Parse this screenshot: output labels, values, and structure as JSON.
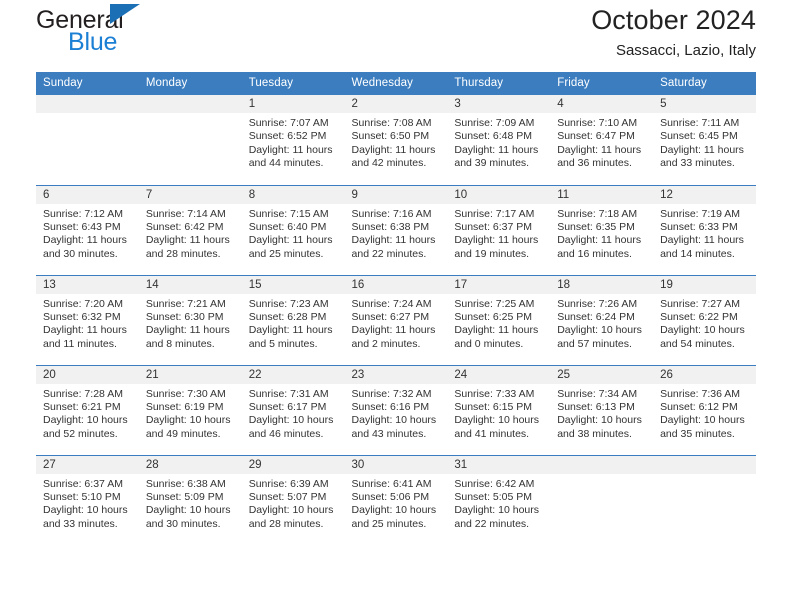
{
  "brand": {
    "name_top": "General",
    "name_bottom": "Blue",
    "triangle_color": "#1b6fb4",
    "text_color": "#231f20",
    "blue_text_color": "#1b7fd4"
  },
  "header": {
    "title": "October 2024",
    "subtitle": "Sassacci, Lazio, Italy"
  },
  "theme": {
    "header_blue": "#3b7dbf",
    "date_band_gray": "#f1f1f1",
    "text_color": "#333333"
  },
  "weekdays": [
    "Sunday",
    "Monday",
    "Tuesday",
    "Wednesday",
    "Thursday",
    "Friday",
    "Saturday"
  ],
  "labels": {
    "sunrise_prefix": "Sunrise:",
    "sunset_prefix": "Sunset:",
    "daylight_prefix": "Daylight:"
  },
  "weeks": [
    [
      {
        "day": "",
        "empty": true
      },
      {
        "day": "",
        "empty": true
      },
      {
        "day": "1",
        "sunrise": "Sunrise: 7:07 AM",
        "sunset": "Sunset: 6:52 PM",
        "daylight_line1": "Daylight: 11 hours",
        "daylight_line2": "and 44 minutes."
      },
      {
        "day": "2",
        "sunrise": "Sunrise: 7:08 AM",
        "sunset": "Sunset: 6:50 PM",
        "daylight_line1": "Daylight: 11 hours",
        "daylight_line2": "and 42 minutes."
      },
      {
        "day": "3",
        "sunrise": "Sunrise: 7:09 AM",
        "sunset": "Sunset: 6:48 PM",
        "daylight_line1": "Daylight: 11 hours",
        "daylight_line2": "and 39 minutes."
      },
      {
        "day": "4",
        "sunrise": "Sunrise: 7:10 AM",
        "sunset": "Sunset: 6:47 PM",
        "daylight_line1": "Daylight: 11 hours",
        "daylight_line2": "and 36 minutes."
      },
      {
        "day": "5",
        "sunrise": "Sunrise: 7:11 AM",
        "sunset": "Sunset: 6:45 PM",
        "daylight_line1": "Daylight: 11 hours",
        "daylight_line2": "and 33 minutes."
      }
    ],
    [
      {
        "day": "6",
        "sunrise": "Sunrise: 7:12 AM",
        "sunset": "Sunset: 6:43 PM",
        "daylight_line1": "Daylight: 11 hours",
        "daylight_line2": "and 30 minutes."
      },
      {
        "day": "7",
        "sunrise": "Sunrise: 7:14 AM",
        "sunset": "Sunset: 6:42 PM",
        "daylight_line1": "Daylight: 11 hours",
        "daylight_line2": "and 28 minutes."
      },
      {
        "day": "8",
        "sunrise": "Sunrise: 7:15 AM",
        "sunset": "Sunset: 6:40 PM",
        "daylight_line1": "Daylight: 11 hours",
        "daylight_line2": "and 25 minutes."
      },
      {
        "day": "9",
        "sunrise": "Sunrise: 7:16 AM",
        "sunset": "Sunset: 6:38 PM",
        "daylight_line1": "Daylight: 11 hours",
        "daylight_line2": "and 22 minutes."
      },
      {
        "day": "10",
        "sunrise": "Sunrise: 7:17 AM",
        "sunset": "Sunset: 6:37 PM",
        "daylight_line1": "Daylight: 11 hours",
        "daylight_line2": "and 19 minutes."
      },
      {
        "day": "11",
        "sunrise": "Sunrise: 7:18 AM",
        "sunset": "Sunset: 6:35 PM",
        "daylight_line1": "Daylight: 11 hours",
        "daylight_line2": "and 16 minutes."
      },
      {
        "day": "12",
        "sunrise": "Sunrise: 7:19 AM",
        "sunset": "Sunset: 6:33 PM",
        "daylight_line1": "Daylight: 11 hours",
        "daylight_line2": "and 14 minutes."
      }
    ],
    [
      {
        "day": "13",
        "sunrise": "Sunrise: 7:20 AM",
        "sunset": "Sunset: 6:32 PM",
        "daylight_line1": "Daylight: 11 hours",
        "daylight_line2": "and 11 minutes."
      },
      {
        "day": "14",
        "sunrise": "Sunrise: 7:21 AM",
        "sunset": "Sunset: 6:30 PM",
        "daylight_line1": "Daylight: 11 hours",
        "daylight_line2": "and 8 minutes."
      },
      {
        "day": "15",
        "sunrise": "Sunrise: 7:23 AM",
        "sunset": "Sunset: 6:28 PM",
        "daylight_line1": "Daylight: 11 hours",
        "daylight_line2": "and 5 minutes."
      },
      {
        "day": "16",
        "sunrise": "Sunrise: 7:24 AM",
        "sunset": "Sunset: 6:27 PM",
        "daylight_line1": "Daylight: 11 hours",
        "daylight_line2": "and 2 minutes."
      },
      {
        "day": "17",
        "sunrise": "Sunrise: 7:25 AM",
        "sunset": "Sunset: 6:25 PM",
        "daylight_line1": "Daylight: 11 hours",
        "daylight_line2": "and 0 minutes."
      },
      {
        "day": "18",
        "sunrise": "Sunrise: 7:26 AM",
        "sunset": "Sunset: 6:24 PM",
        "daylight_line1": "Daylight: 10 hours",
        "daylight_line2": "and 57 minutes."
      },
      {
        "day": "19",
        "sunrise": "Sunrise: 7:27 AM",
        "sunset": "Sunset: 6:22 PM",
        "daylight_line1": "Daylight: 10 hours",
        "daylight_line2": "and 54 minutes."
      }
    ],
    [
      {
        "day": "20",
        "sunrise": "Sunrise: 7:28 AM",
        "sunset": "Sunset: 6:21 PM",
        "daylight_line1": "Daylight: 10 hours",
        "daylight_line2": "and 52 minutes."
      },
      {
        "day": "21",
        "sunrise": "Sunrise: 7:30 AM",
        "sunset": "Sunset: 6:19 PM",
        "daylight_line1": "Daylight: 10 hours",
        "daylight_line2": "and 49 minutes."
      },
      {
        "day": "22",
        "sunrise": "Sunrise: 7:31 AM",
        "sunset": "Sunset: 6:17 PM",
        "daylight_line1": "Daylight: 10 hours",
        "daylight_line2": "and 46 minutes."
      },
      {
        "day": "23",
        "sunrise": "Sunrise: 7:32 AM",
        "sunset": "Sunset: 6:16 PM",
        "daylight_line1": "Daylight: 10 hours",
        "daylight_line2": "and 43 minutes."
      },
      {
        "day": "24",
        "sunrise": "Sunrise: 7:33 AM",
        "sunset": "Sunset: 6:15 PM",
        "daylight_line1": "Daylight: 10 hours",
        "daylight_line2": "and 41 minutes."
      },
      {
        "day": "25",
        "sunrise": "Sunrise: 7:34 AM",
        "sunset": "Sunset: 6:13 PM",
        "daylight_line1": "Daylight: 10 hours",
        "daylight_line2": "and 38 minutes."
      },
      {
        "day": "26",
        "sunrise": "Sunrise: 7:36 AM",
        "sunset": "Sunset: 6:12 PM",
        "daylight_line1": "Daylight: 10 hours",
        "daylight_line2": "and 35 minutes."
      }
    ],
    [
      {
        "day": "27",
        "sunrise": "Sunrise: 6:37 AM",
        "sunset": "Sunset: 5:10 PM",
        "daylight_line1": "Daylight: 10 hours",
        "daylight_line2": "and 33 minutes."
      },
      {
        "day": "28",
        "sunrise": "Sunrise: 6:38 AM",
        "sunset": "Sunset: 5:09 PM",
        "daylight_line1": "Daylight: 10 hours",
        "daylight_line2": "and 30 minutes."
      },
      {
        "day": "29",
        "sunrise": "Sunrise: 6:39 AM",
        "sunset": "Sunset: 5:07 PM",
        "daylight_line1": "Daylight: 10 hours",
        "daylight_line2": "and 28 minutes."
      },
      {
        "day": "30",
        "sunrise": "Sunrise: 6:41 AM",
        "sunset": "Sunset: 5:06 PM",
        "daylight_line1": "Daylight: 10 hours",
        "daylight_line2": "and 25 minutes."
      },
      {
        "day": "31",
        "sunrise": "Sunrise: 6:42 AM",
        "sunset": "Sunset: 5:05 PM",
        "daylight_line1": "Daylight: 10 hours",
        "daylight_line2": "and 22 minutes."
      },
      {
        "day": "",
        "empty": true
      },
      {
        "day": "",
        "empty": true
      }
    ]
  ]
}
